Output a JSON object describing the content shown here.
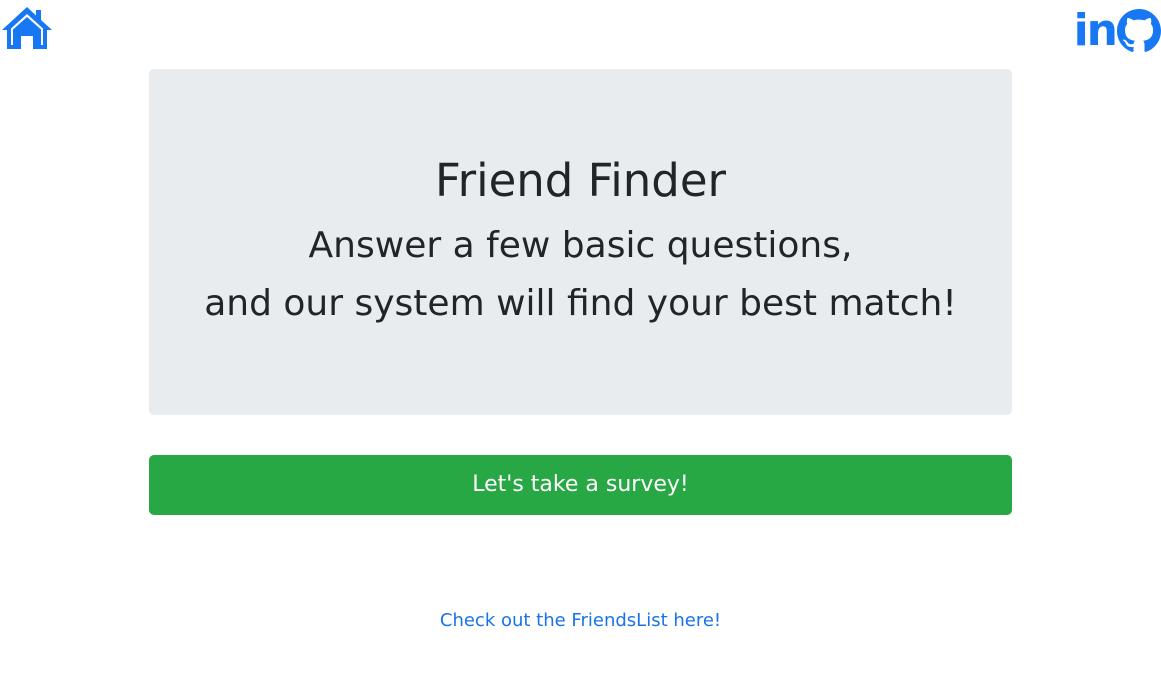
{
  "nav": {
    "home_icon": "home-icon",
    "linkedin_label": "in",
    "github_icon": "github-icon",
    "icon_color": "#1877f2"
  },
  "hero": {
    "title": "Friend Finder",
    "subtitle_line1": "Answer a few basic questions,",
    "subtitle_line2": "and our system will find your best match!"
  },
  "actions": {
    "survey_button_label": "Let's take a survey!",
    "survey_button_color": "#28a745",
    "friends_list_link": "Check out the FriendsList here!"
  }
}
